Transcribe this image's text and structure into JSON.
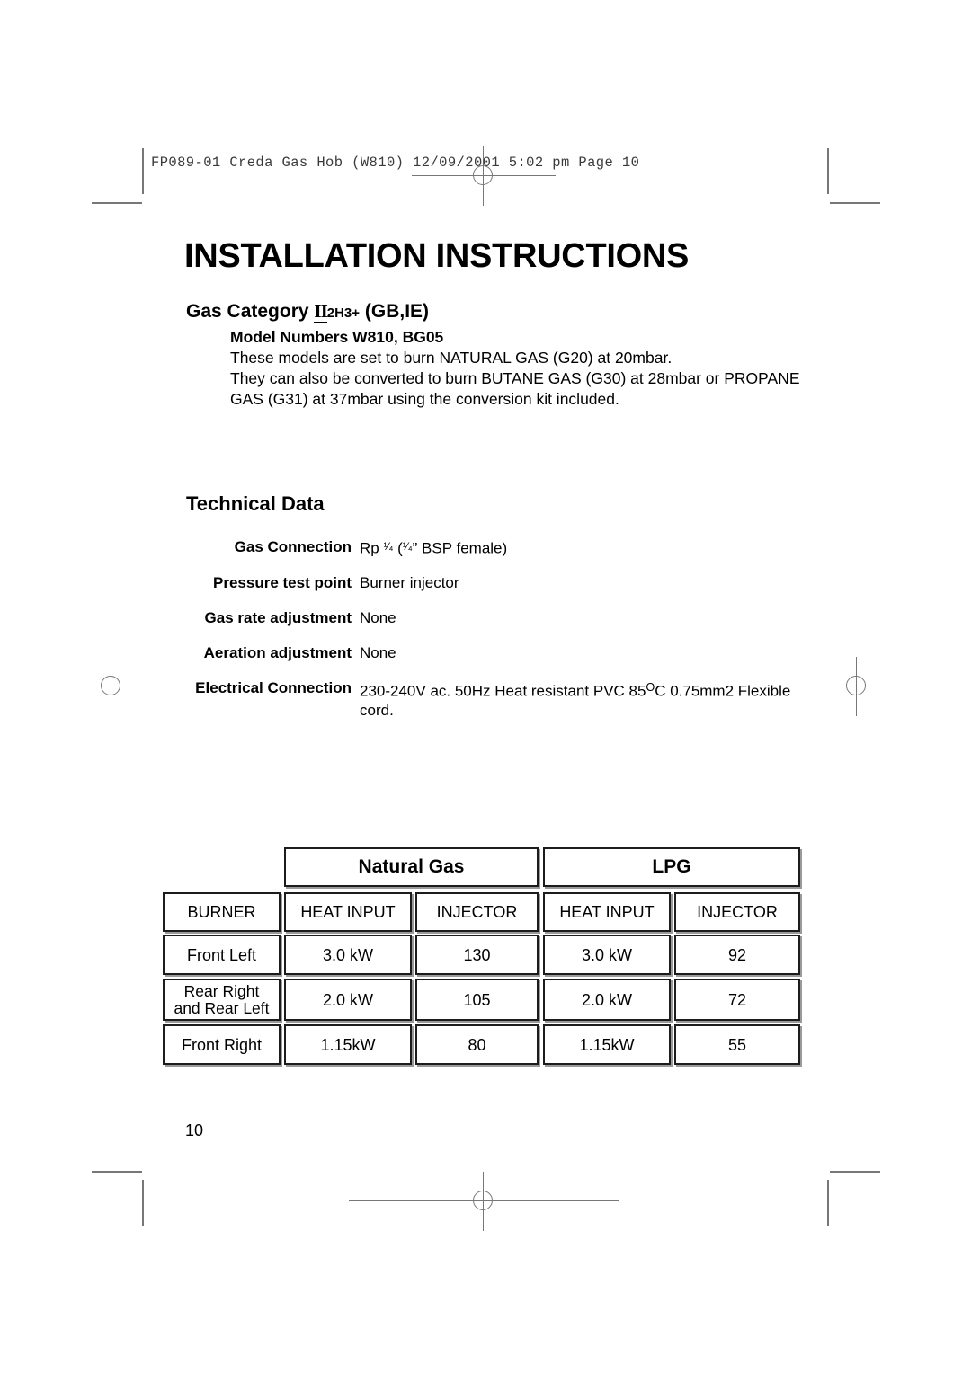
{
  "print_slug": "FP089-01 Creda Gas Hob (W810)  12/09/2001  5:02 pm  Page 10",
  "document": {
    "title": "INSTALLATION INSTRUCTIONS",
    "gas_category": {
      "prefix": "Gas Category ",
      "numeral": "II",
      "subscript": "2H3+",
      "suffix": " (GB,IE)"
    },
    "model_block": {
      "heading": "Model Numbers W810, BG05",
      "lines": [
        "These models are set to burn NATURAL GAS (G20) at 20mbar.",
        "They can also be converted to burn BUTANE GAS (G30) at 28mbar or PROPANE",
        "GAS (G31) at 37mbar using the conversion kit included."
      ]
    },
    "technical_data": {
      "heading": "Technical Data",
      "rows": [
        {
          "label": "Gas Connection",
          "value_pre": "Rp ",
          "value_frac1": "1/4",
          "value_mid": " (",
          "value_frac2": "1/4",
          "value_post": "” BSP female)"
        },
        {
          "label": "Pressure test point",
          "value": "Burner injector"
        },
        {
          "label": "Gas rate adjustment",
          "value": "None"
        },
        {
          "label": "Aeration adjustment",
          "value": "None"
        },
        {
          "label": "Electrical Connection",
          "value_pre": "230-240V ac. 50Hz  Heat resistant PVC 85",
          "value_sup": "O",
          "value_post": "C 0.75mm2 Flexible cord."
        }
      ]
    },
    "burner_matrix": {
      "group_headers": [
        "Natural Gas",
        "LPG"
      ],
      "column_headers": [
        "BURNER",
        "HEAT INPUT",
        "INJECTOR",
        "HEAT INPUT",
        "INJECTOR"
      ],
      "rows": [
        {
          "burner": "Front Left",
          "burner_line2": "",
          "ng_heat": "3.0 kW",
          "ng_injector": "130",
          "lpg_heat": "3.0 kW",
          "lpg_injector": "92"
        },
        {
          "burner": "Rear Right",
          "burner_line2": "and Rear Left",
          "ng_heat": "2.0 kW",
          "ng_injector": "105",
          "lpg_heat": "2.0 kW",
          "lpg_injector": "72"
        },
        {
          "burner": "Front Right",
          "burner_line2": "",
          "ng_heat": "1.15kW",
          "ng_injector": "80",
          "lpg_heat": "1.15kW",
          "lpg_injector": "55"
        }
      ]
    },
    "page_number": "10"
  },
  "colors": {
    "text": "#000000",
    "slug": "#3a3a3a",
    "cell_border": "#1c1c1c",
    "cell_shadow": "#9a9a9a",
    "crop_mark": "#777777"
  }
}
